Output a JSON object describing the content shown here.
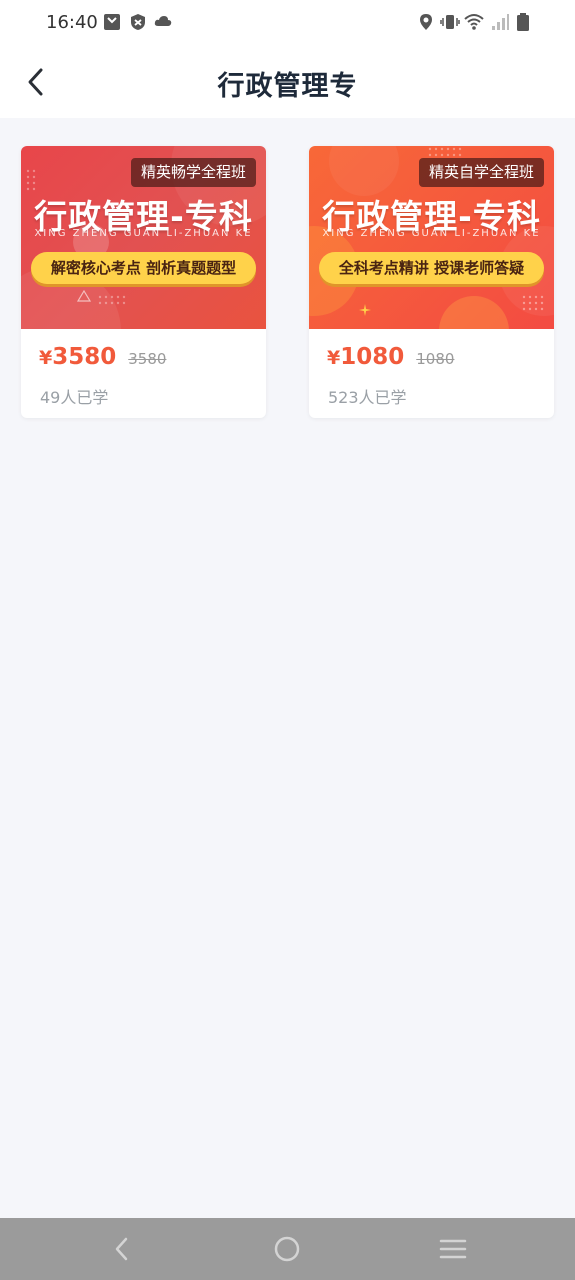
{
  "status_bar": {
    "time": "16:40",
    "left_icons": [
      "sim-card-icon",
      "shield-icon",
      "cloud-icon"
    ],
    "right_icons": [
      "location-icon",
      "vibrate-icon",
      "wifi-icon",
      "signal-icon",
      "battery-icon"
    ]
  },
  "header": {
    "title": "行政管理专",
    "back_icon": "chevron-left-icon"
  },
  "courses": [
    {
      "tag": "精英畅学全程班",
      "banner_title": "行政管理-专科",
      "banner_subtitle": "XING ZHENG GUAN LI-ZHUAN KE",
      "banner_slogan": "解密核心考点 剖析真题题型",
      "currency": "¥",
      "price": "3580",
      "original_price": "3580",
      "learners": "49人已学"
    },
    {
      "tag": "精英自学全程班",
      "banner_title": "行政管理-专科",
      "banner_subtitle": "XING ZHENG GUAN LI-ZHUAN KE",
      "banner_slogan": "全科考点精讲 授课老师答疑",
      "currency": "¥",
      "price": "1080",
      "original_price": "1080",
      "learners": "523人已学"
    }
  ],
  "system_nav": [
    "back-icon",
    "home-icon",
    "menu-icon"
  ],
  "colors": {
    "accent_price": "#f15a3b",
    "banner_red": "#e8464a",
    "banner_orange": "#f86838",
    "slogan_yellow": "#ffd24a",
    "page_bg": "#f5f6fa"
  }
}
